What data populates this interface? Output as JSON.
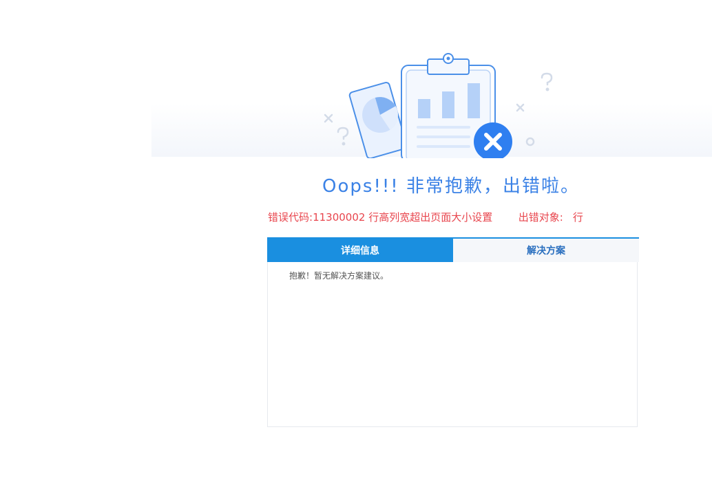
{
  "illustration": {
    "icon": "clipboard-error-illustration",
    "accent": "#3b82e6",
    "error_badge_color": "#2f7ff0"
  },
  "headline": "Oops!!! 非常抱歉，出错啦。",
  "error": {
    "code_label": "错误代码:",
    "code_value": "11300002",
    "message": "行高列宽超出页面大小设置",
    "object_label": "出错对象:",
    "object_value": "行",
    "color": "#e8454d"
  },
  "tabs": [
    {
      "label": "详细信息",
      "active": true
    },
    {
      "label": "解决方案",
      "active": false
    }
  ],
  "panel": {
    "text": "抱歉！暂无解决方案建议。"
  }
}
